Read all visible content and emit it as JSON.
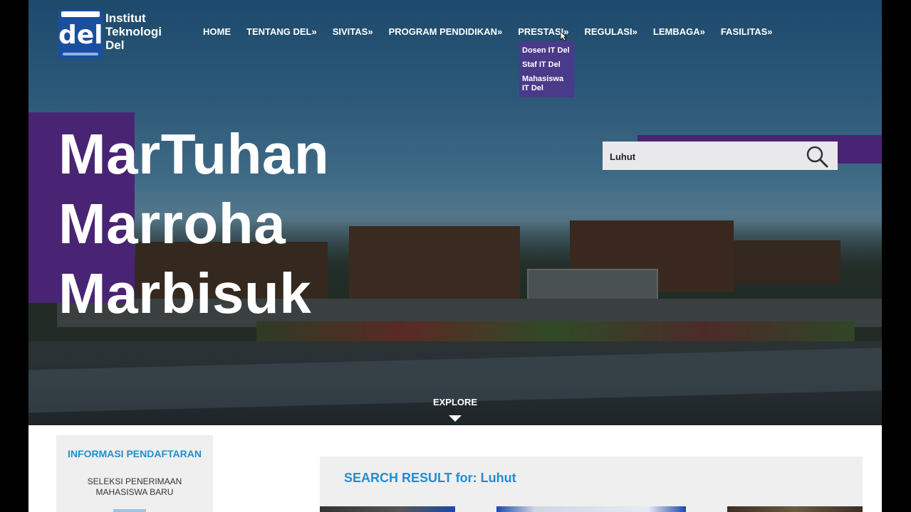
{
  "brand": {
    "logo_text": "del",
    "name_line1": "Institut",
    "name_line2": "Teknologi",
    "name_line3": "Del"
  },
  "nav": {
    "items": [
      {
        "label": "HOME"
      },
      {
        "label": "TENTANG DEL»"
      },
      {
        "label": "SIVITAS»"
      },
      {
        "label": "PROGRAM PENDIDIKAN»"
      },
      {
        "label": "PRESTASI»"
      },
      {
        "label": "REGULASI»"
      },
      {
        "label": "LEMBAGA»"
      },
      {
        "label": "FASILITAS»"
      }
    ],
    "dropdown": {
      "parent": "PRESTASI»",
      "items": [
        {
          "label": "Dosen IT Del"
        },
        {
          "label": "Staf IT Del"
        },
        {
          "label": "Mahasiswa IT Del"
        }
      ]
    }
  },
  "hero": {
    "line1": "MarTuhan",
    "line2": "Marroha",
    "line3": "Marbisuk",
    "explore": "EXPLORE"
  },
  "search": {
    "value": "Luhut",
    "icon": "search-icon"
  },
  "sidebar": {
    "title": "INFORMASI PENDAFTARAN",
    "text_line1": "SELEKSI PENERIMAAN",
    "text_line2": "MAHASISWA BARU"
  },
  "results": {
    "title": "SEARCH RESULT for: Luhut"
  },
  "colors": {
    "purple": "#4a2474",
    "accent_blue": "#1f8fd0",
    "dropdown_bg": "#4a3a8a",
    "logo_blue": "#1a4fa0"
  }
}
